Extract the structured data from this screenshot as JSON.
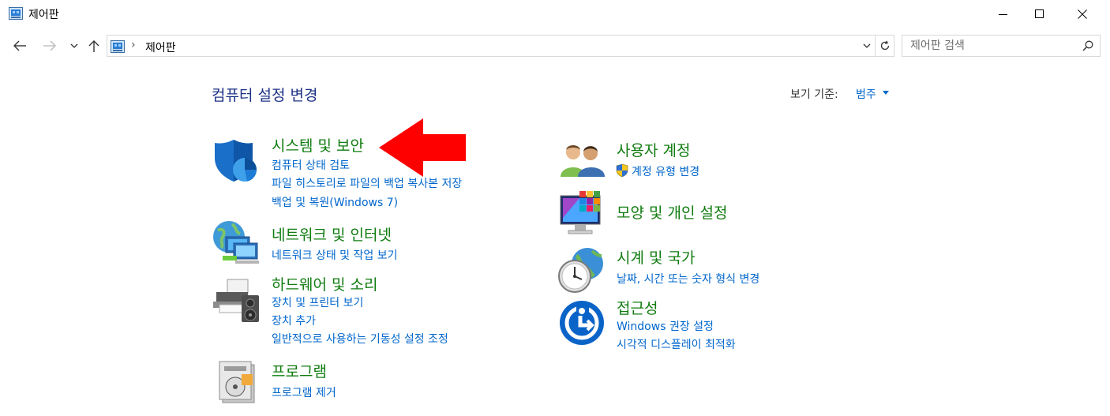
{
  "window": {
    "title": "제어판"
  },
  "address_bar": {
    "breadcrumb": "제어판"
  },
  "search": {
    "placeholder": "제어판 검색"
  },
  "page": {
    "title": "컴퓨터 설정 변경",
    "view_by_label": "보기 기준:",
    "view_by_value": "범주"
  },
  "left_categories": [
    {
      "title": "시스템 및 보안",
      "icon": "shield-icon",
      "links": [
        "컴퓨터 상태 검토",
        "파일 히스토리로 파일의 백업 복사본 저장",
        "백업 및 복원(Windows 7)"
      ]
    },
    {
      "title": "네트워크 및 인터넷",
      "icon": "network-icon",
      "links": [
        "네트워크 상태 및 작업 보기"
      ]
    },
    {
      "title": "하드웨어 및 소리",
      "icon": "printer-icon",
      "links": [
        "장치 및 프린터 보기",
        "장치 추가",
        "일반적으로 사용하는 기동성 설정 조정"
      ]
    },
    {
      "title": "프로그램",
      "icon": "programs-icon",
      "links": [
        "프로그램 제거"
      ]
    }
  ],
  "right_categories": [
    {
      "title": "사용자 계정",
      "icon": "users-icon",
      "links": [
        "계정 유형 변경"
      ]
    },
    {
      "title": "모양 및 개인 설정",
      "icon": "display-icon",
      "links": []
    },
    {
      "title": "시계 및 국가",
      "icon": "clock-globe-icon",
      "links": [
        "날짜, 시간 또는 숫자 형식 변경"
      ]
    },
    {
      "title": "접근성",
      "icon": "accessibility-icon",
      "links": [
        "Windows 권장 설정",
        "시각적 디스플레이 최적화"
      ]
    }
  ],
  "colors": {
    "category_title": "#107c10",
    "link": "#0066cc",
    "page_title": "#1e3287",
    "annotation_arrow": "#ff0000"
  }
}
